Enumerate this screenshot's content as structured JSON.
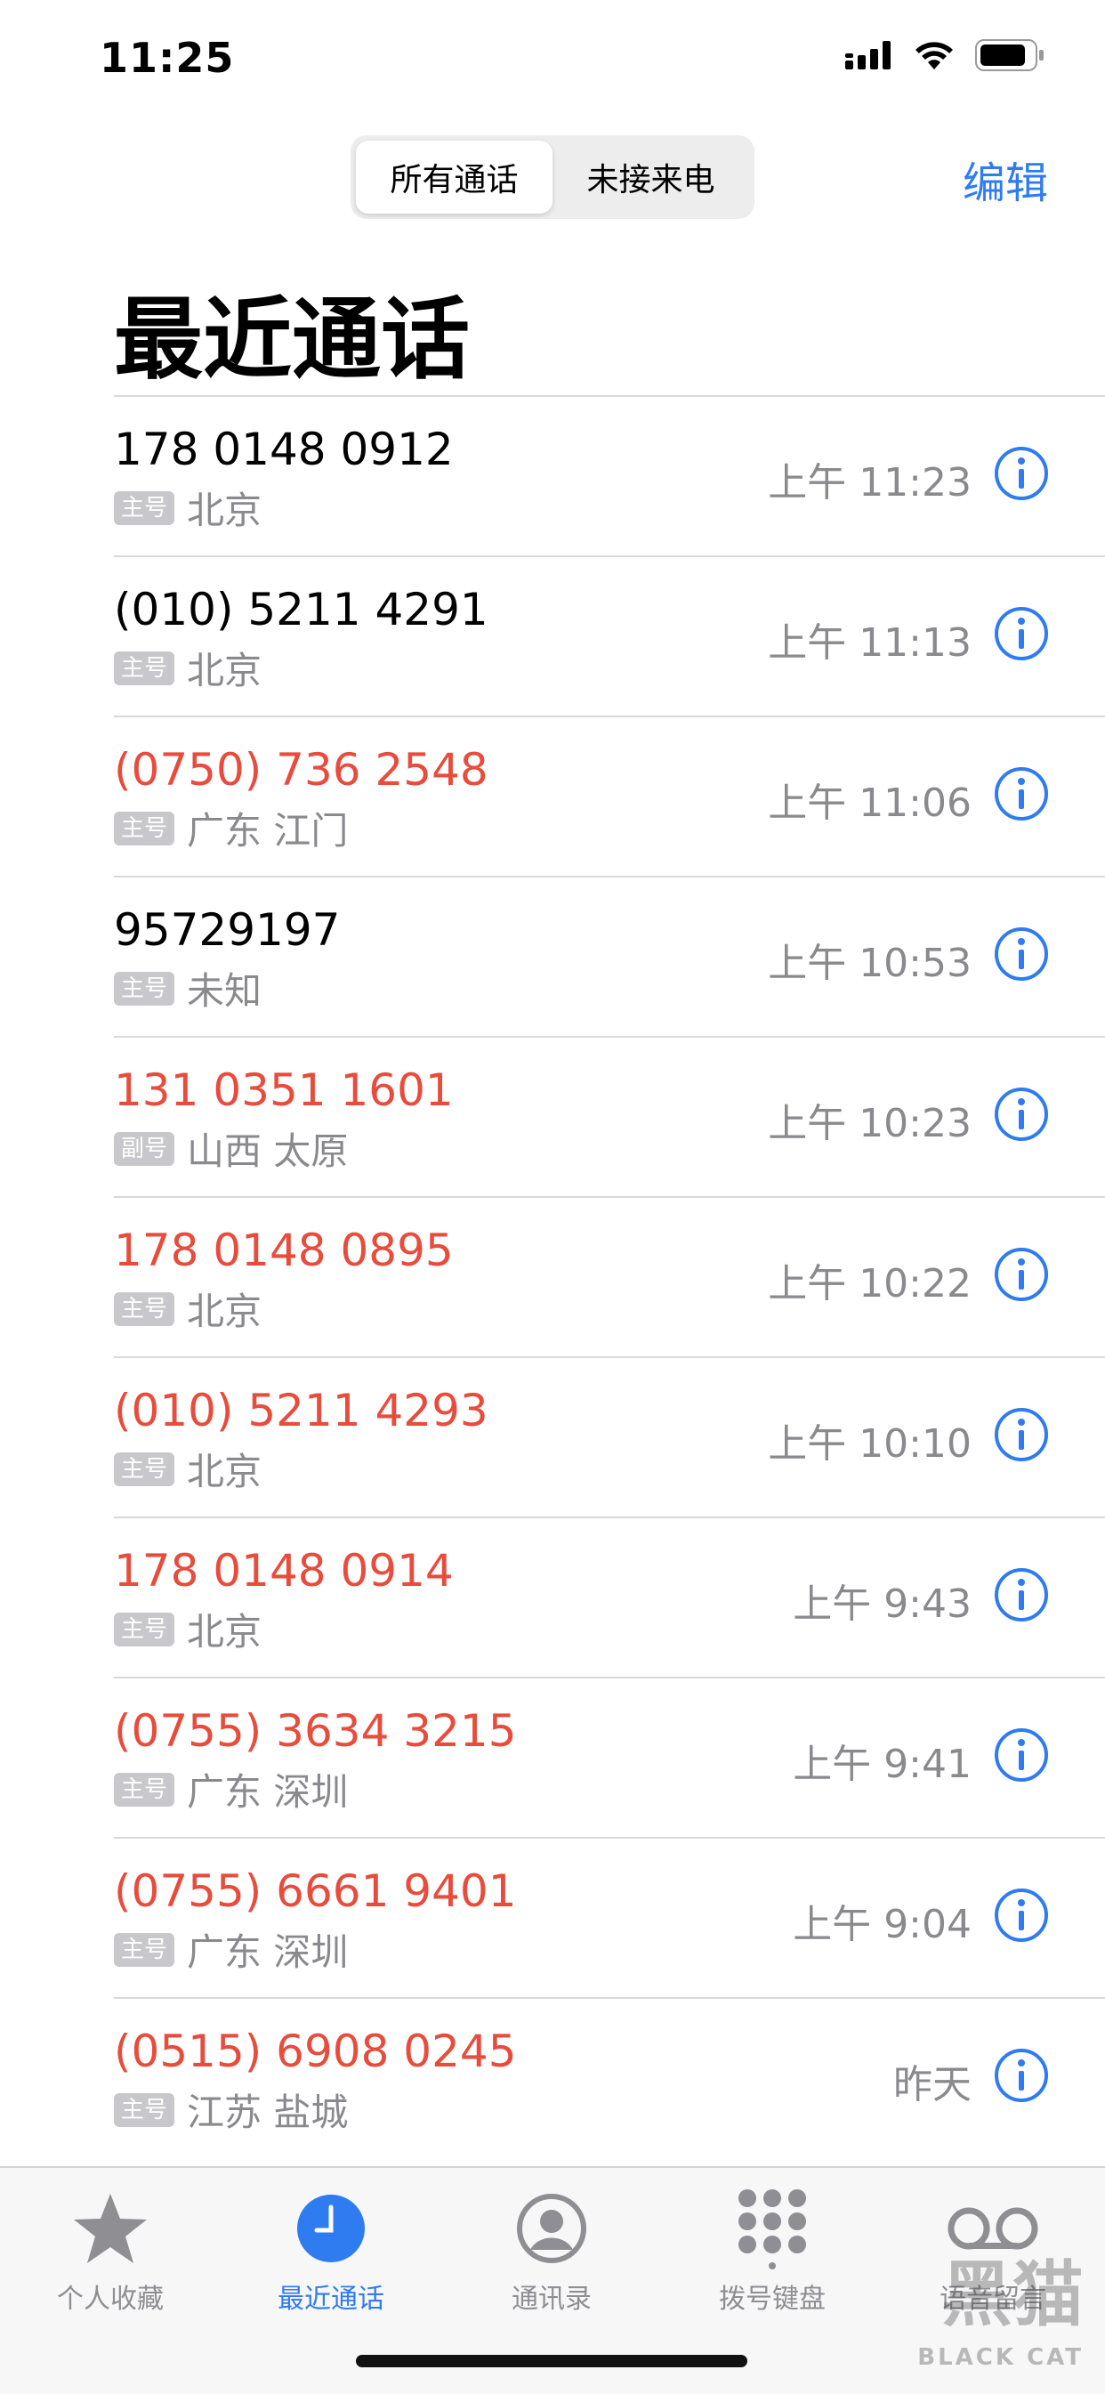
{
  "status_bar": {
    "time": "11:25"
  },
  "nav": {
    "segments": [
      "所有通话",
      "未接来电"
    ],
    "active_segment": 0,
    "edit_label": "编辑"
  },
  "page_title": "最近通话",
  "calls": [
    {
      "number": "178 0148 0912",
      "tag": "主号",
      "location": "北京",
      "time": "上午 11:23",
      "missed": false
    },
    {
      "number": "(010) 5211 4291",
      "tag": "主号",
      "location": "北京",
      "time": "上午 11:13",
      "missed": false
    },
    {
      "number": "(0750) 736 2548",
      "tag": "主号",
      "location": "广东 江门",
      "time": "上午 11:06",
      "missed": true
    },
    {
      "number": "95729197",
      "tag": "主号",
      "location": "未知",
      "time": "上午 10:53",
      "missed": false
    },
    {
      "number": "131 0351 1601",
      "tag": "副号",
      "location": "山西 太原",
      "time": "上午 10:23",
      "missed": true
    },
    {
      "number": "178 0148 0895",
      "tag": "主号",
      "location": "北京",
      "time": "上午 10:22",
      "missed": true
    },
    {
      "number": "(010) 5211 4293",
      "tag": "主号",
      "location": "北京",
      "time": "上午 10:10",
      "missed": true
    },
    {
      "number": "178 0148 0914",
      "tag": "主号",
      "location": "北京",
      "time": "上午 9:43",
      "missed": true
    },
    {
      "number": "(0755) 3634 3215",
      "tag": "主号",
      "location": "广东 深圳",
      "time": "上午 9:41",
      "missed": true
    },
    {
      "number": "(0755) 6661 9401",
      "tag": "主号",
      "location": "广东 深圳",
      "time": "上午 9:04",
      "missed": true
    },
    {
      "number": "(0515) 6908 0245",
      "tag": "主号",
      "location": "江苏 盐城",
      "time": "昨天",
      "missed": true
    }
  ],
  "tabs": [
    {
      "label": "个人收藏",
      "icon": "star-icon"
    },
    {
      "label": "最近通话",
      "icon": "clock-icon",
      "active": true
    },
    {
      "label": "通讯录",
      "icon": "contacts-icon"
    },
    {
      "label": "拨号键盘",
      "icon": "keypad-icon"
    },
    {
      "label": "语音留言",
      "icon": "voicemail-icon"
    }
  ],
  "watermark": {
    "cn": "黑猫",
    "en": "BLACK CAT"
  },
  "colors": {
    "accent": "#2f7bf0",
    "missed": "#e74c3c",
    "secondary": "#8a8a8e"
  }
}
